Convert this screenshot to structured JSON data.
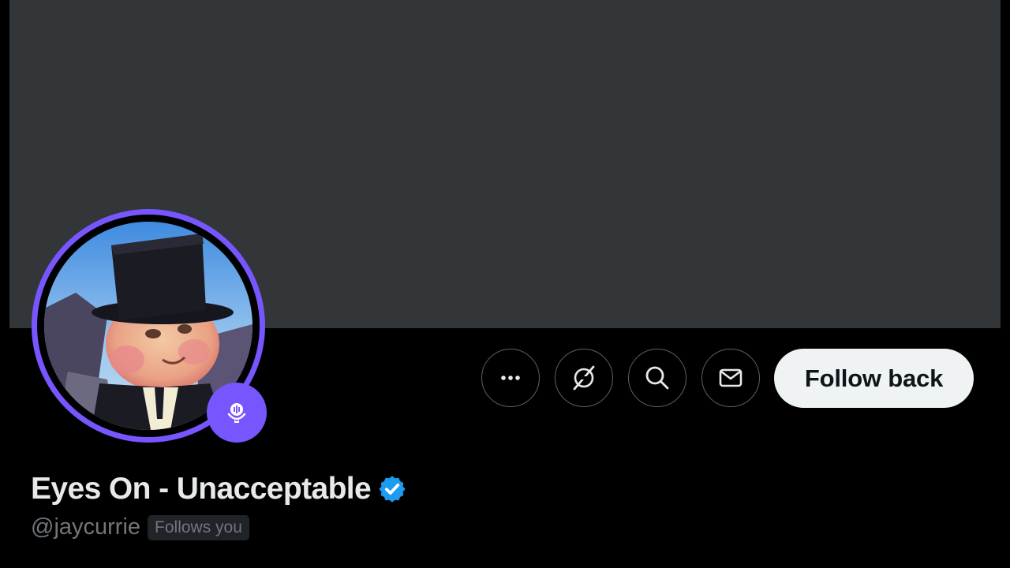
{
  "profile": {
    "display_name": "Eyes On - Unacceptable",
    "handle": "@jaycurrie",
    "follows_badge": "Follows you",
    "verified": true
  },
  "actions": {
    "more_icon": "more-horizontal-icon",
    "grok_icon": "grok-icon",
    "search_icon": "search-icon",
    "message_icon": "mail-icon",
    "follow_label": "Follow back"
  },
  "colors": {
    "banner": "#333639",
    "avatar_ring": "#7856ff",
    "verified": "#1d9bf0",
    "background": "#000000",
    "follow_button": "#eff3f4"
  }
}
